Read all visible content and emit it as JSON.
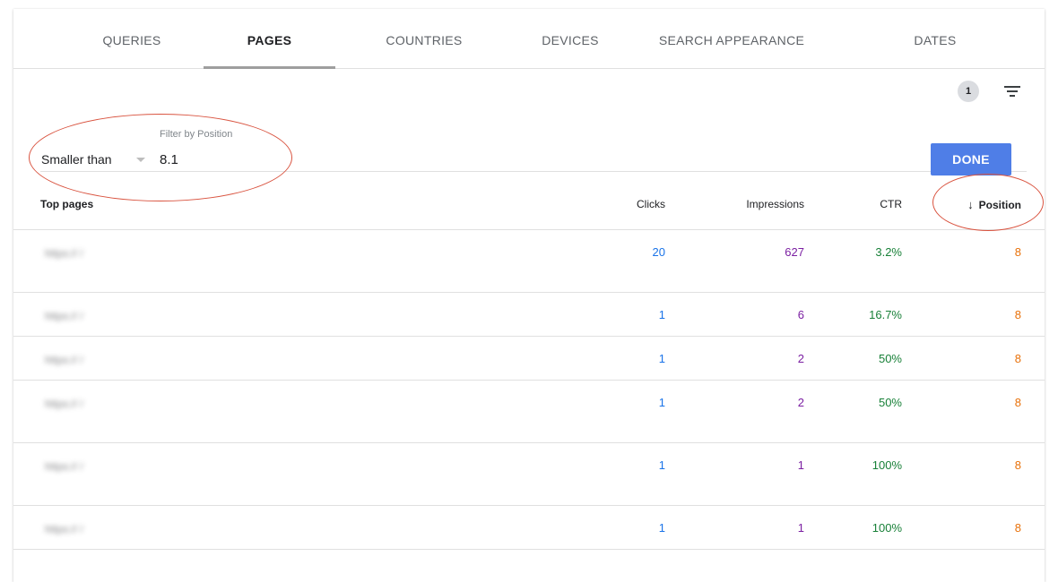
{
  "tabs": [
    {
      "label": "QUERIES",
      "active": false
    },
    {
      "label": "PAGES",
      "active": true
    },
    {
      "label": "COUNTRIES",
      "active": false
    },
    {
      "label": "DEVICES",
      "active": false
    },
    {
      "label": "SEARCH APPEARANCE",
      "active": false
    },
    {
      "label": "DATES",
      "active": false
    }
  ],
  "toolbar": {
    "filter_count": "1",
    "filter_icon": "filter-list-icon"
  },
  "filter": {
    "label": "Filter by Position",
    "operator": "Smaller than",
    "value": "8.1",
    "done_label": "DONE"
  },
  "table": {
    "headers": {
      "page": "Top pages",
      "clicks": "Clicks",
      "impressions": "Impressions",
      "ctr": "CTR",
      "position": "Position",
      "sort_icon": "arrow-down-icon"
    },
    "rows": [
      {
        "url": "https://                                                                        /",
        "clicks": "20",
        "impressions": "627",
        "ctr": "3.2%",
        "position": "8"
      },
      {
        "url": "https://                                              /",
        "clicks": "1",
        "impressions": "6",
        "ctr": "16.7%",
        "position": "8"
      },
      {
        "url": "https://                                                   /",
        "clicks": "1",
        "impressions": "2",
        "ctr": "50%",
        "position": "8"
      },
      {
        "url": "https://                                                                         /",
        "clicks": "1",
        "impressions": "2",
        "ctr": "50%",
        "position": "8"
      },
      {
        "url": "https://                                                                      /",
        "clicks": "1",
        "impressions": "1",
        "ctr": "100%",
        "position": "8"
      },
      {
        "url": "https://                                                           /",
        "clicks": "1",
        "impressions": "1",
        "ctr": "100%",
        "position": "8"
      }
    ]
  },
  "colors": {
    "clicks": "#1a73e8",
    "impressions": "#7b1fa2",
    "ctr": "#188038",
    "position": "#e8710a",
    "done_button": "#4f7ee7",
    "annotation": "#d9533f"
  }
}
